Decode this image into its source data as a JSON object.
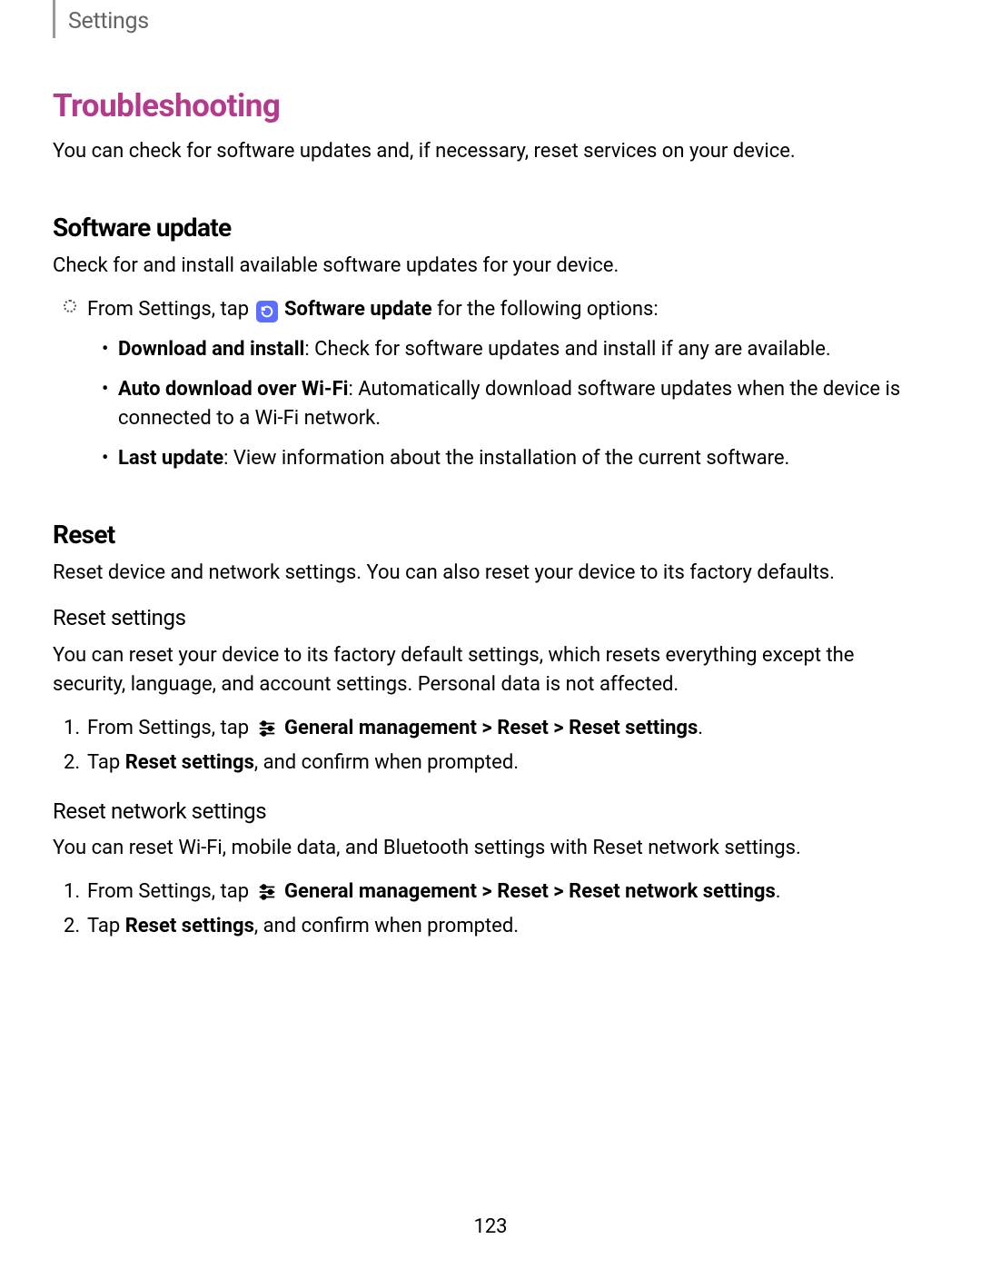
{
  "header": {
    "breadcrumb": "Settings"
  },
  "title": "Troubleshooting",
  "intro": "You can check for software updates and, if necessary, reset services on your device.",
  "software_update": {
    "heading": "Software update",
    "desc": "Check for and install available software updates for your device.",
    "lead_pre": "From Settings, tap ",
    "lead_bold": "Software update",
    "lead_post": " for the following options:",
    "items": [
      {
        "term": "Download and install",
        "desc": ": Check for software updates and install if any are available."
      },
      {
        "term": "Auto download over Wi-Fi",
        "desc": ": Automatically download software updates when the device is connected to a Wi-Fi network."
      },
      {
        "term": "Last update",
        "desc": ": View information about the installation of the current software."
      }
    ]
  },
  "reset": {
    "heading": "Reset",
    "desc": "Reset device and network settings. You can also reset your device to its factory defaults.",
    "reset_settings": {
      "heading": "Reset settings",
      "desc": "You can reset your device to its factory default settings, which resets everything except the security, language, and account settings. Personal data is not affected.",
      "step1_pre": "From Settings, tap ",
      "step1_bold": "General management > Reset > Reset settings",
      "step1_post": ".",
      "step2_pre": "Tap ",
      "step2_bold": "Reset settings",
      "step2_post": ", and confirm when prompted."
    },
    "reset_network": {
      "heading": "Reset network settings",
      "desc": "You can reset Wi-Fi, mobile data, and Bluetooth settings with Reset network settings.",
      "step1_pre": "From Settings, tap ",
      "step1_bold": "General management > Reset > Reset network settings",
      "step1_post": ".",
      "step2_pre": "Tap ",
      "step2_bold": "Reset settings",
      "step2_post": ", and confirm when prompted."
    }
  },
  "page_number": "123"
}
